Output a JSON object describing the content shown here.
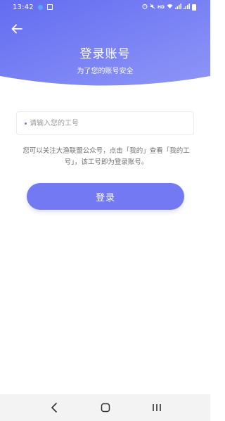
{
  "status_bar": {
    "time": "13:42",
    "icons": [
      "notification-icon",
      "message-icon",
      "alarm-icon",
      "mute-icon",
      "hd-icon",
      "wifi-icon",
      "signal-icon",
      "hd-signal-icon",
      "battery-icon"
    ],
    "right_text": "HD"
  },
  "header": {
    "title": "登录账号",
    "subtitle": "为了您的账号安全",
    "gradient_start": "#6a73f0",
    "gradient_end": "#8a93f7"
  },
  "form": {
    "employee_id_placeholder": "请输入您的工号",
    "employee_id_value": ""
  },
  "hint": {
    "text": "您可以关注大渔联盟公众号，点击「我的」查看「我的工号」，该工号即为登录账号。"
  },
  "actions": {
    "login_label": "登录",
    "accent": "#7279f2"
  },
  "nav": {
    "buttons": [
      "back-nav-icon",
      "home-icon",
      "recents-icon"
    ]
  }
}
